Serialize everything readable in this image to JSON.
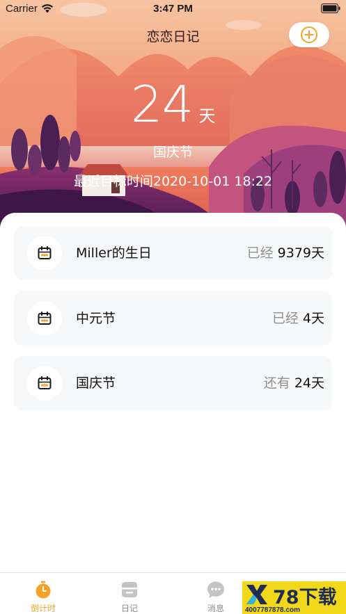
{
  "status_bar": {
    "carrier": "Carrier",
    "time": "3:47 PM"
  },
  "nav": {
    "title": "恋恋日记",
    "add_icon": "plus-circle-icon"
  },
  "hero": {
    "count": "24",
    "unit": "天",
    "event_name": "国庆节",
    "target_time": "最近目标时间2020-10-01 18:22"
  },
  "events": [
    {
      "title": "Miller的生日",
      "prefix": "已经",
      "value": "9379天",
      "icon": "calendar-icon"
    },
    {
      "title": "中元节",
      "prefix": "已经",
      "value": "4天",
      "icon": "calendar-icon"
    },
    {
      "title": "国庆节",
      "prefix": "还有",
      "value": "24天",
      "icon": "calendar-icon"
    }
  ],
  "tabs": [
    {
      "label": "倒计时",
      "icon": "stopwatch-icon",
      "active": true
    },
    {
      "label": "日记",
      "icon": "diary-icon",
      "active": false
    },
    {
      "label": "消息",
      "icon": "message-icon",
      "active": false
    }
  ],
  "watermark": {
    "brand": "78下载",
    "number": "4007787878.com"
  },
  "colors": {
    "accent": "#f4a326",
    "text": "#111111",
    "secondary_text": "#8f8f8f",
    "card_bg": "#f7f8fa"
  }
}
